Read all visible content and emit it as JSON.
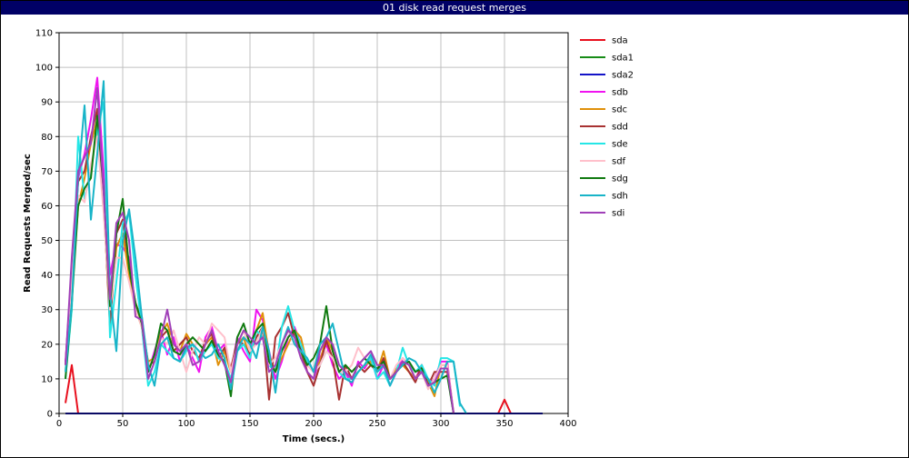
{
  "chart_data": {
    "type": "line",
    "title": "01 disk read request merges",
    "xlabel": "Time (secs.)",
    "ylabel": "Read Requests Merged/sec",
    "xlim": [
      0,
      400
    ],
    "ylim": [
      0,
      110
    ],
    "xticks": [
      0,
      50,
      100,
      150,
      200,
      250,
      300,
      350,
      400
    ],
    "yticks": [
      0,
      10,
      20,
      30,
      40,
      50,
      60,
      70,
      80,
      90,
      100,
      110
    ],
    "grid": true,
    "legend_position": "right",
    "series": [
      {
        "name": "sda",
        "color": "#e8101e",
        "x": [
          5,
          10,
          15,
          20,
          40,
          60,
          100,
          150,
          200,
          250,
          300,
          345,
          350,
          355,
          360,
          380
        ],
        "y": [
          3,
          14,
          0,
          0,
          0,
          0,
          0,
          0,
          0,
          0,
          0,
          0,
          4,
          0,
          0,
          0
        ]
      },
      {
        "name": "sda1",
        "color": "#178c17",
        "x": [
          5,
          15,
          50,
          100,
          150,
          200,
          250,
          300,
          350,
          380
        ],
        "y": [
          0,
          0,
          0,
          0,
          0,
          0,
          0,
          0,
          0,
          0
        ]
      },
      {
        "name": "sda2",
        "color": "#1414c8",
        "x": [
          5,
          15,
          50,
          100,
          150,
          200,
          250,
          300,
          350,
          380
        ],
        "y": [
          0,
          0,
          0,
          0,
          0,
          0,
          0,
          0,
          0,
          0
        ]
      },
      {
        "name": "sdb",
        "color": "#f014f0",
        "x": [
          5,
          10,
          15,
          20,
          25,
          30,
          35,
          40,
          45,
          50,
          55,
          60,
          65,
          70,
          75,
          80,
          85,
          90,
          95,
          100,
          105,
          110,
          115,
          120,
          125,
          130,
          135,
          140,
          145,
          150,
          155,
          160,
          165,
          170,
          175,
          180,
          185,
          190,
          195,
          200,
          205,
          210,
          215,
          220,
          225,
          230,
          235,
          240,
          245,
          250,
          255,
          260,
          265,
          270,
          275,
          280,
          285,
          290,
          295,
          300,
          305,
          310
        ],
        "y": [
          15,
          40,
          68,
          75,
          85,
          97,
          70,
          40,
          49,
          48,
          45,
          30,
          28,
          12,
          18,
          24,
          17,
          22,
          15,
          20,
          16,
          12,
          22,
          25,
          18,
          20,
          12,
          22,
          18,
          15,
          30,
          27,
          18,
          10,
          15,
          22,
          25,
          20,
          12,
          10,
          16,
          20,
          14,
          10,
          12,
          8,
          15,
          13,
          16,
          10,
          14,
          8,
          12,
          16,
          14,
          10,
          14,
          8,
          10,
          15,
          15,
          0
        ]
      },
      {
        "name": "sdc",
        "color": "#e0900a",
        "x": [
          5,
          10,
          15,
          20,
          25,
          30,
          35,
          40,
          45,
          50,
          55,
          60,
          65,
          70,
          75,
          80,
          85,
          90,
          95,
          100,
          105,
          110,
          115,
          120,
          125,
          130,
          135,
          140,
          145,
          150,
          155,
          160,
          165,
          170,
          175,
          180,
          185,
          190,
          195,
          200,
          205,
          210,
          215,
          220,
          225,
          230,
          235,
          240,
          245,
          250,
          255,
          260,
          265,
          270,
          275,
          280,
          285,
          290,
          295,
          300,
          305,
          310
        ],
        "y": [
          12,
          35,
          60,
          68,
          78,
          85,
          60,
          27,
          48,
          52,
          40,
          30,
          25,
          15,
          16,
          23,
          26,
          20,
          18,
          23,
          20,
          15,
          20,
          22,
          14,
          18,
          12,
          20,
          22,
          16,
          24,
          29,
          17,
          12,
          16,
          20,
          24,
          22,
          14,
          12,
          15,
          22,
          18,
          12,
          10,
          10,
          12,
          14,
          15,
          12,
          18,
          10,
          13,
          14,
          12,
          10,
          13,
          9,
          5,
          14,
          14,
          0
        ]
      },
      {
        "name": "sdd",
        "color": "#a83232",
        "x": [
          5,
          10,
          15,
          20,
          25,
          30,
          35,
          40,
          45,
          50,
          55,
          60,
          65,
          70,
          75,
          80,
          85,
          90,
          95,
          100,
          105,
          110,
          115,
          120,
          125,
          130,
          135,
          140,
          145,
          150,
          155,
          160,
          165,
          170,
          175,
          180,
          185,
          190,
          195,
          200,
          205,
          210,
          215,
          220,
          225,
          230,
          235,
          240,
          245,
          250,
          255,
          260,
          265,
          270,
          275,
          280,
          285,
          290,
          295,
          300,
          305,
          310
        ],
        "y": [
          14,
          42,
          67,
          70,
          80,
          88,
          62,
          25,
          52,
          56,
          43,
          32,
          27,
          14,
          15,
          22,
          24,
          18,
          20,
          22,
          18,
          16,
          21,
          23,
          16,
          19,
          13,
          21,
          20,
          17,
          22,
          25,
          4,
          22,
          25,
          29,
          22,
          18,
          12,
          8,
          14,
          21,
          16,
          4,
          14,
          10,
          14,
          12,
          14,
          12,
          16,
          10,
          12,
          15,
          12,
          9,
          14,
          8,
          12,
          12,
          12,
          0
        ]
      },
      {
        "name": "sde",
        "color": "#25e6e6",
        "x": [
          5,
          10,
          15,
          20,
          25,
          30,
          35,
          40,
          45,
          50,
          55,
          60,
          65,
          70,
          75,
          80,
          85,
          90,
          95,
          100,
          105,
          110,
          115,
          120,
          125,
          130,
          135,
          140,
          145,
          150,
          155,
          160,
          165,
          170,
          175,
          180,
          185,
          190,
          195,
          200,
          205,
          210,
          215,
          220,
          225,
          230,
          235,
          240,
          245,
          250,
          255,
          260,
          265,
          270,
          275,
          280,
          285,
          290,
          295,
          300,
          305,
          310,
          315
        ],
        "y": [
          10,
          30,
          80,
          62,
          70,
          82,
          90,
          22,
          38,
          55,
          58,
          40,
          25,
          8,
          12,
          20,
          18,
          16,
          15,
          18,
          20,
          15,
          18,
          20,
          16,
          15,
          10,
          18,
          20,
          16,
          24,
          22,
          14,
          12,
          25,
          31,
          24,
          20,
          15,
          12,
          14,
          18,
          16,
          12,
          10,
          10,
          12,
          14,
          16,
          10,
          12,
          8,
          12,
          19,
          14,
          12,
          14,
          10,
          8,
          16,
          16,
          15,
          2
        ]
      },
      {
        "name": "sdf",
        "color": "#ffc0cb",
        "x": [
          5,
          10,
          15,
          20,
          25,
          30,
          35,
          40,
          45,
          50,
          55,
          60,
          65,
          70,
          75,
          80,
          85,
          90,
          95,
          100,
          105,
          110,
          115,
          120,
          125,
          130,
          135,
          140,
          145,
          150,
          155,
          160,
          165,
          170,
          175,
          180,
          185,
          190,
          195,
          200,
          205,
          210,
          215,
          220,
          225,
          230,
          235,
          240,
          245,
          250,
          255,
          260,
          265,
          270,
          275,
          280,
          285,
          290,
          295,
          300,
          305,
          310
        ],
        "y": [
          12,
          38,
          63,
          61,
          72,
          80,
          58,
          30,
          45,
          45,
          38,
          30,
          25,
          14,
          16,
          22,
          20,
          24,
          18,
          12,
          18,
          22,
          20,
          26,
          24,
          22,
          12,
          20,
          24,
          18,
          20,
          25,
          14,
          16,
          20,
          24,
          20,
          18,
          14,
          12,
          14,
          18,
          16,
          12,
          12,
          14,
          19,
          16,
          18,
          12,
          14,
          10,
          14,
          16,
          14,
          10,
          12,
          7,
          10,
          14,
          14,
          0
        ]
      },
      {
        "name": "sdg",
        "color": "#107a10",
        "x": [
          5,
          10,
          15,
          20,
          25,
          30,
          35,
          40,
          45,
          50,
          55,
          60,
          65,
          70,
          75,
          80,
          85,
          90,
          95,
          100,
          105,
          110,
          115,
          120,
          125,
          130,
          135,
          140,
          145,
          150,
          155,
          160,
          165,
          170,
          175,
          180,
          185,
          190,
          195,
          200,
          205,
          210,
          215,
          220,
          225,
          230,
          235,
          240,
          245,
          250,
          255,
          260,
          265,
          270,
          275,
          280,
          285,
          290,
          295,
          300,
          305,
          310
        ],
        "y": [
          10,
          32,
          60,
          65,
          68,
          86,
          65,
          31,
          52,
          62,
          42,
          32,
          26,
          12,
          17,
          26,
          24,
          18,
          17,
          20,
          22,
          20,
          18,
          21,
          17,
          15,
          5,
          22,
          26,
          20,
          24,
          26,
          15,
          12,
          18,
          22,
          24,
          18,
          14,
          16,
          20,
          31,
          18,
          12,
          14,
          12,
          14,
          16,
          14,
          13,
          15,
          10,
          12,
          14,
          15,
          12,
          13,
          8,
          9,
          10,
          11,
          0
        ]
      },
      {
        "name": "sdh",
        "color": "#18b4c8",
        "x": [
          5,
          10,
          15,
          20,
          25,
          30,
          35,
          40,
          45,
          50,
          55,
          60,
          65,
          70,
          75,
          80,
          85,
          90,
          95,
          100,
          105,
          110,
          115,
          120,
          125,
          130,
          135,
          140,
          145,
          150,
          155,
          160,
          165,
          170,
          175,
          180,
          185,
          190,
          195,
          200,
          205,
          210,
          215,
          220,
          225,
          230,
          235,
          240,
          245,
          250,
          255,
          260,
          265,
          270,
          275,
          280,
          285,
          290,
          295,
          300,
          305,
          310,
          315,
          320
        ],
        "y": [
          12,
          32,
          68,
          89,
          56,
          75,
          96,
          35,
          18,
          50,
          59,
          45,
          28,
          14,
          8,
          20,
          22,
          16,
          15,
          19,
          20,
          18,
          16,
          17,
          20,
          16,
          7,
          18,
          22,
          20,
          16,
          25,
          18,
          6,
          20,
          25,
          20,
          18,
          16,
          12,
          20,
          22,
          26,
          18,
          10,
          9,
          12,
          14,
          17,
          12,
          14,
          8,
          12,
          14,
          16,
          15,
          12,
          10,
          6,
          10,
          15,
          15,
          3,
          0
        ]
      },
      {
        "name": "sdi",
        "color": "#a040b8",
        "x": [
          5,
          10,
          15,
          20,
          25,
          30,
          35,
          40,
          45,
          50,
          55,
          60,
          65,
          70,
          75,
          80,
          85,
          90,
          95,
          100,
          105,
          110,
          115,
          120,
          125,
          130,
          135,
          140,
          145,
          150,
          155,
          160,
          165,
          170,
          175,
          180,
          185,
          190,
          195,
          200,
          205,
          210,
          215,
          220,
          225,
          230,
          235,
          240,
          245,
          250,
          255,
          260,
          265,
          270,
          275,
          280,
          285,
          290,
          295,
          300,
          305,
          310
        ],
        "y": [
          14,
          45,
          70,
          74,
          78,
          94,
          64,
          33,
          55,
          58,
          50,
          28,
          27,
          10,
          15,
          22,
          30,
          20,
          18,
          20,
          14,
          15,
          20,
          24,
          18,
          14,
          9,
          20,
          24,
          22,
          20,
          22,
          12,
          14,
          20,
          24,
          22,
          16,
          12,
          10,
          18,
          22,
          20,
          14,
          12,
          10,
          14,
          16,
          18,
          14,
          14,
          10,
          12,
          15,
          14,
          10,
          12,
          8,
          9,
          13,
          13,
          0
        ]
      }
    ]
  }
}
